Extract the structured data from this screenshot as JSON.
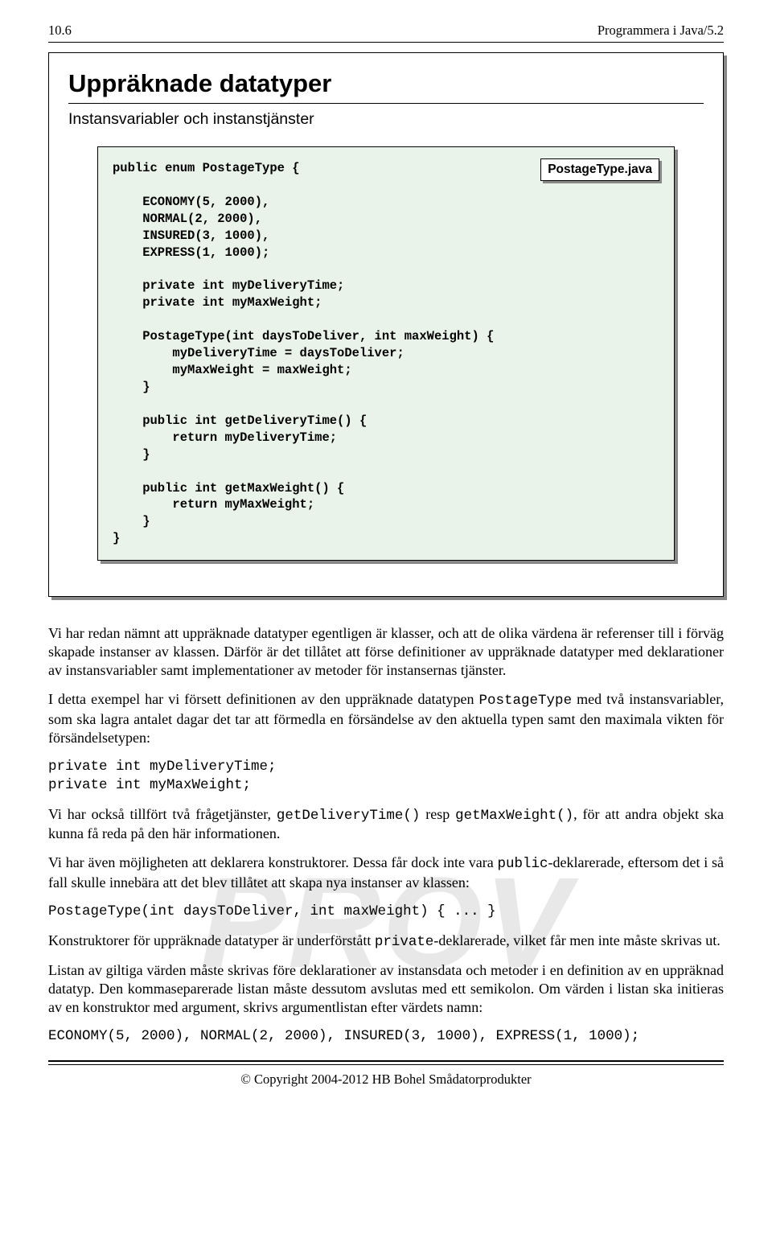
{
  "header": {
    "page_number": "10.6",
    "section": "Programmera i Java/5.2"
  },
  "panel": {
    "title": "Uppräknade datatyper",
    "subtitle": "Instansvariabler och instanstjänster",
    "code": "public enum PostageType {\n\n    ECONOMY(5, 2000),\n    NORMAL(2, 2000),\n    INSURED(3, 1000),\n    EXPRESS(1, 1000);\n\n    private int myDeliveryTime;\n    private int myMaxWeight;\n\n    PostageType(int daysToDeliver, int maxWeight) {\n        myDeliveryTime = daysToDeliver;\n        myMaxWeight = maxWeight;\n    }\n\n    public int getDeliveryTime() {\n        return myDeliveryTime;\n    }\n\n    public int getMaxWeight() {\n        return myMaxWeight;\n    }\n}",
    "file_tag": "PostageType.java"
  },
  "body": {
    "p1a": "Vi har redan nämnt att uppräknade datatyper egentligen är klasser, och att de olika värdena är referenser till i förväg skapade instanser av klassen. Därför är det tillåtet att förse definitioner av uppräknade data­typer med deklarationer av instansvariabler samt implementationer av metoder för instansernas tjänster.",
    "p2a": "I detta exempel har vi försett definitionen av den uppräknade datatypen ",
    "p2_code1": "PostageType",
    "p2b": " med två instans­variabler, som ska lagra antalet dagar det tar att förmedla en försändelse av den aktuella typen samt den maximala vikten för försändelsetypen:",
    "code_block1": "private int myDeliveryTime;\nprivate int myMaxWeight;",
    "p3a": "Vi har också tillfört två frågetjänster, ",
    "p3_code1": "getDeliveryTime()",
    "p3b": " resp ",
    "p3_code2": "getMaxWeight()",
    "p3c": ", för att andra objekt ska kunna få reda på den här informationen.",
    "p4a": "Vi har även möjligheten att deklarera konstruktorer. Dessa får dock inte vara ",
    "p4_code1": "public",
    "p4b": "-deklarerade, eftersom det i så fall skulle innebära att det blev tillåtet att skapa nya instanser av klassen:",
    "code_block2": "PostageType(int daysToDeliver, int maxWeight) { ... }",
    "p5a": "Konstruktorer för uppräknade datatyper är underförstått ",
    "p5_code1": "private",
    "p5b": "-deklarerade, vilket får men inte måste skrivas ut.",
    "p6": "Listan av giltiga värden måste skrivas före deklarationer av instansdata och metoder i en definition av en uppräknad datatyp. Den kommaseparerade listan måste dessutom avslutas med ett semikolon. Om vär­den i listan ska initieras av en konstruktor med argument, skrivs argumentlistan efter värdets namn:",
    "code_block3": "ECONOMY(5, 2000), NORMAL(2, 2000), INSURED(3, 1000), EXPRESS(1, 1000);"
  },
  "watermark": "PROV",
  "footer": "© Copyright 2004-2012 HB Bohel Smådatorprodukter"
}
